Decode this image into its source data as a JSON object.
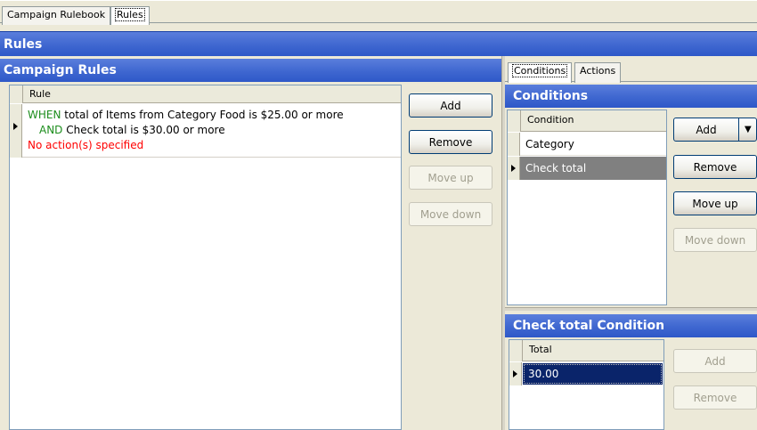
{
  "tabs": [
    {
      "label": "Campaign Rulebook"
    },
    {
      "label": "Rules"
    }
  ],
  "header": {
    "title": "Rules"
  },
  "campaign_rules": {
    "title": "Campaign Rules",
    "column_header": "Rule",
    "rule": {
      "when_keyword": "WHEN",
      "when_text": " total of Items from Category Food is $25.00 or more",
      "and_keyword": "AND",
      "and_text": " Check total is $30.00 or more",
      "no_action": "No action(s) specified"
    },
    "buttons": {
      "add": "Add",
      "remove": "Remove",
      "move_up": "Move up",
      "move_down": "Move down"
    }
  },
  "right_tabs": [
    {
      "label": "Conditions"
    },
    {
      "label": "Actions"
    }
  ],
  "conditions": {
    "title": "Conditions",
    "column_header": "Condition",
    "rows": [
      {
        "label": "Category"
      },
      {
        "label": "Check total"
      }
    ],
    "buttons": {
      "add": "Add",
      "remove": "Remove",
      "move_up": "Move up",
      "move_down": "Move down"
    }
  },
  "check_total": {
    "title": "Check total Condition",
    "column_header": "Total",
    "value": "30.00",
    "buttons": {
      "add": "Add",
      "remove": "Remove"
    }
  },
  "colors": {
    "band": "#3f67d0",
    "selection_dark": "#0a246a",
    "selection_gray": "#808080",
    "green": "#1c8d1c",
    "red": "#ff0000"
  }
}
